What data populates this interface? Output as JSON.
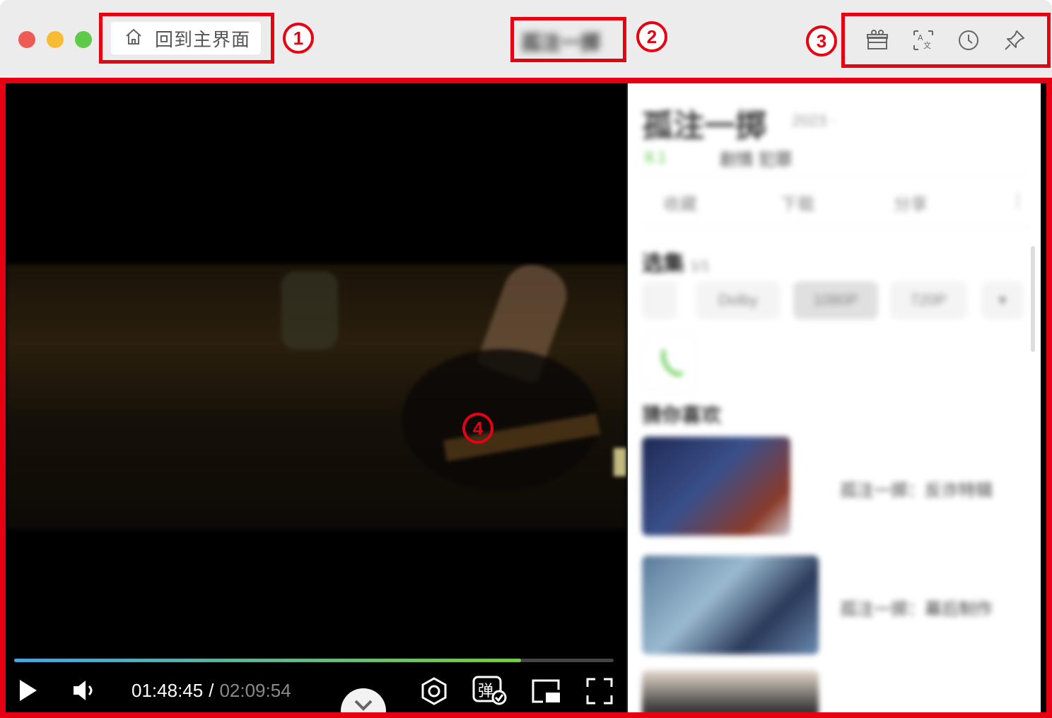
{
  "titlebar": {
    "home_label": "回到主界面",
    "title": "孤注一掷"
  },
  "badges": [
    "1",
    "2",
    "3",
    "4"
  ],
  "toolbar": {
    "icons": [
      "gift-box-icon",
      "translate-icon",
      "history-clock-icon",
      "pin-icon"
    ]
  },
  "player": {
    "current_time": "01:48:45",
    "separator": "/",
    "total_time": "02:09:54",
    "progress": 0.845,
    "danmaku_label": "弹"
  },
  "sidebar": {
    "title": "孤注一掷",
    "title_sub": "2023 ·",
    "tag_score": "8.1",
    "tag_genre": "剧情 犯罪",
    "actions": [
      "收藏",
      "下载",
      "分享",
      "⋮"
    ],
    "section_title": "选集",
    "section_sub": "1/1",
    "quality_pills": [
      "",
      "Dolby",
      "1080P",
      "720P",
      "▾"
    ],
    "recommend_title": "猜你喜欢",
    "recommend_items": [
      "孤注一掷：反诈特辑",
      "孤注一掷：幕后制作"
    ]
  }
}
